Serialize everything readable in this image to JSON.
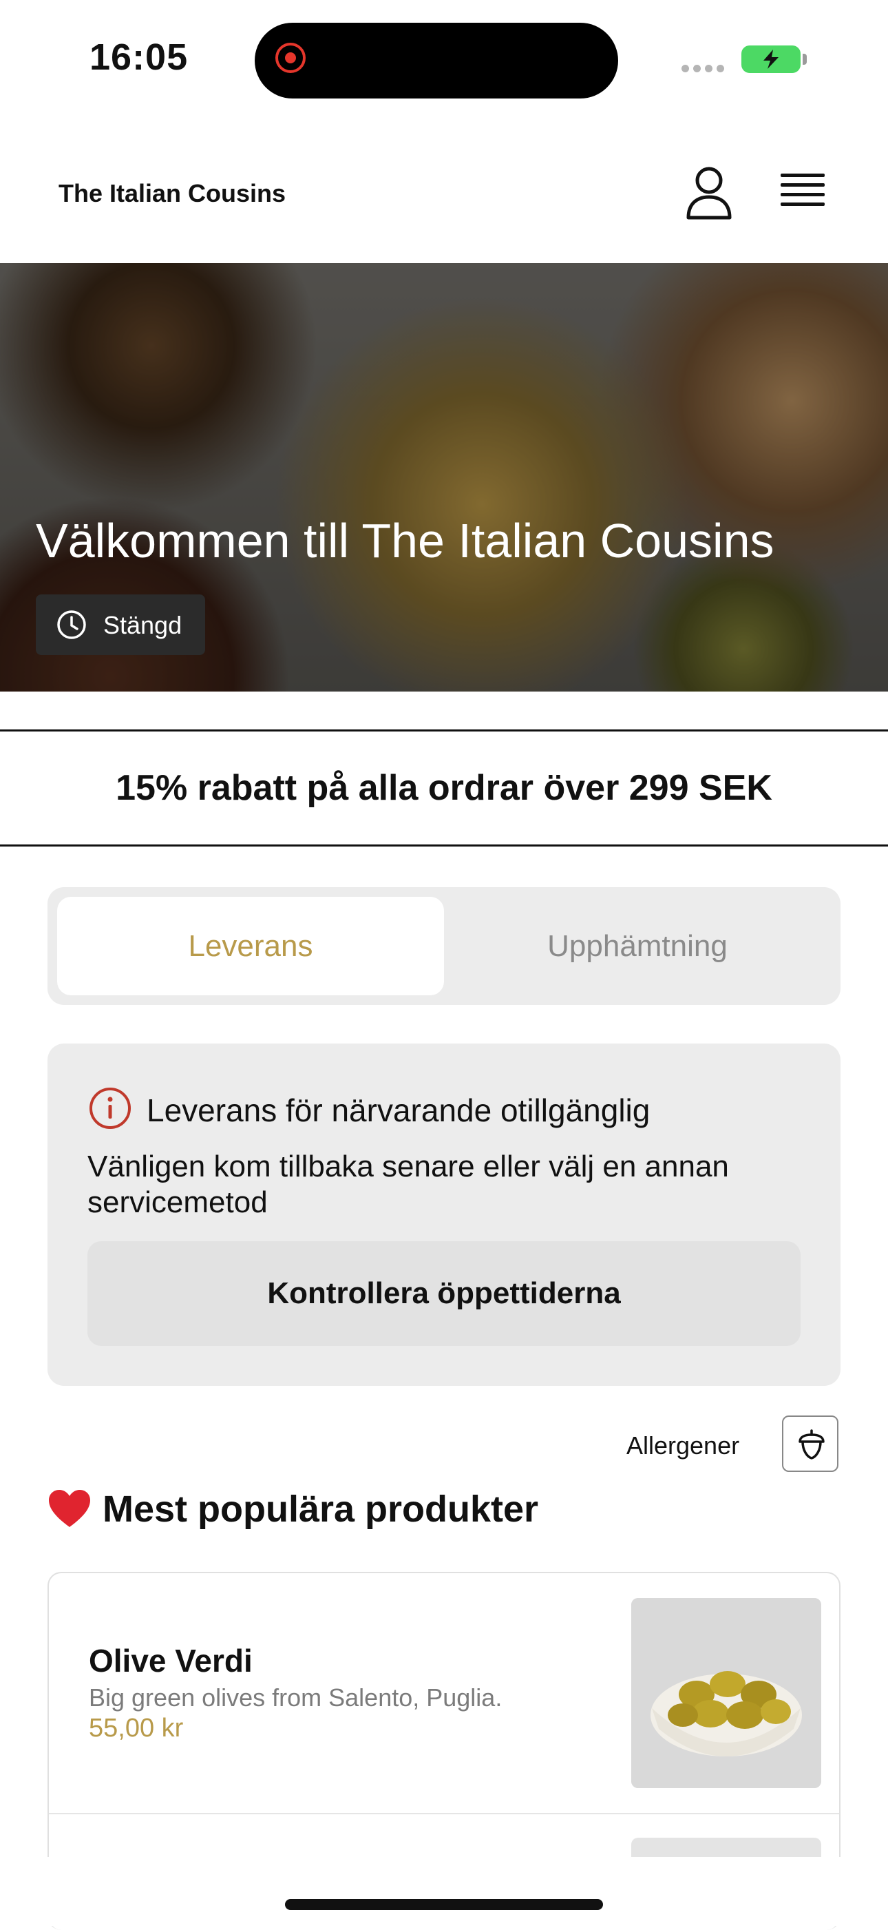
{
  "status_bar": {
    "time": "16:05"
  },
  "header": {
    "brand": "The Italian Cousins",
    "icons": [
      "user-icon",
      "menu-icon"
    ]
  },
  "hero": {
    "title": "Välkommen till The Italian Cousins",
    "status": "Stängd"
  },
  "promo": {
    "text": "15% rabatt på alla ordrar över 299 SEK"
  },
  "service_toggle": {
    "options": [
      "Leverans",
      "Upphämtning"
    ],
    "selected": "Leverans"
  },
  "notice": {
    "title": "Leverans för närvarande otillgänglig",
    "body": "Vänligen kom tillbaka senare eller välj en annan servicemetod",
    "button": "Kontrollera öppettiderna"
  },
  "allergens": {
    "label": "Allergener"
  },
  "popular": {
    "title": "Mest populära produkter",
    "products": [
      {
        "name": "Olive Verdi",
        "description": "Big green olives from Salento, Puglia.",
        "price": "55,00 kr"
      }
    ]
  },
  "colors": {
    "accent": "#b89a4a",
    "panel": "#ececec",
    "alert": "#c0392b",
    "battery": "#4cd964"
  }
}
